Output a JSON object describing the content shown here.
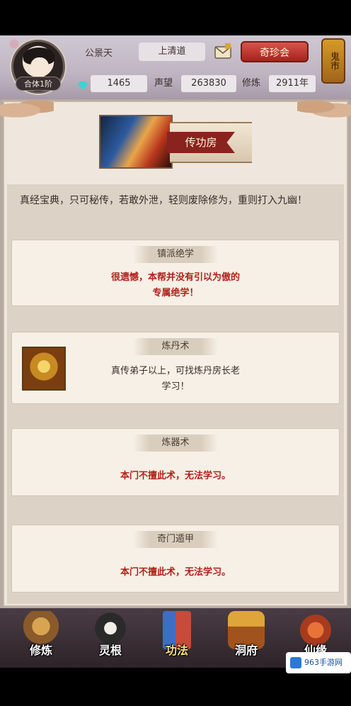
{
  "header": {
    "realm_badge": "合体1阶",
    "player_name": "公景天",
    "sect": "上清道",
    "treasure_button": "奇珍会",
    "ghost_market": "鬼市",
    "stats": {
      "gems": "1465",
      "reputation_label": "声望",
      "reputation_value": "263830",
      "cultivation_label": "修炼",
      "cultivation_value": "2911年"
    }
  },
  "panel": {
    "banner_title": "传功房",
    "rule_text": "真经宝典，只可秘传，若敢外泄，轻则废除修为，重则打入九幽！",
    "cards": [
      {
        "title": "镇派绝学",
        "body_line1": "很遗憾，本帮并没有引以为傲的",
        "body_line2": "专属绝学！"
      },
      {
        "title": "炼丹术",
        "body_line1": "真传弟子以上，可找炼丹房长老",
        "body_line2": "学习！"
      },
      {
        "title": "炼器术",
        "body_line1": "本门不擅此术，无法学习。"
      },
      {
        "title": "奇门遁甲",
        "body_line1": "本门不擅此术，无法学习。"
      }
    ]
  },
  "nav": [
    {
      "label": "修炼",
      "icon": "cultivate-icon"
    },
    {
      "label": "灵根",
      "icon": "spirit-root-icon"
    },
    {
      "label": "功法",
      "icon": "technique-icon"
    },
    {
      "label": "洞府",
      "icon": "cave-dwelling-icon"
    },
    {
      "label": "仙缘",
      "icon": "immortal-fate-icon"
    }
  ],
  "watermark": "963手游网"
}
